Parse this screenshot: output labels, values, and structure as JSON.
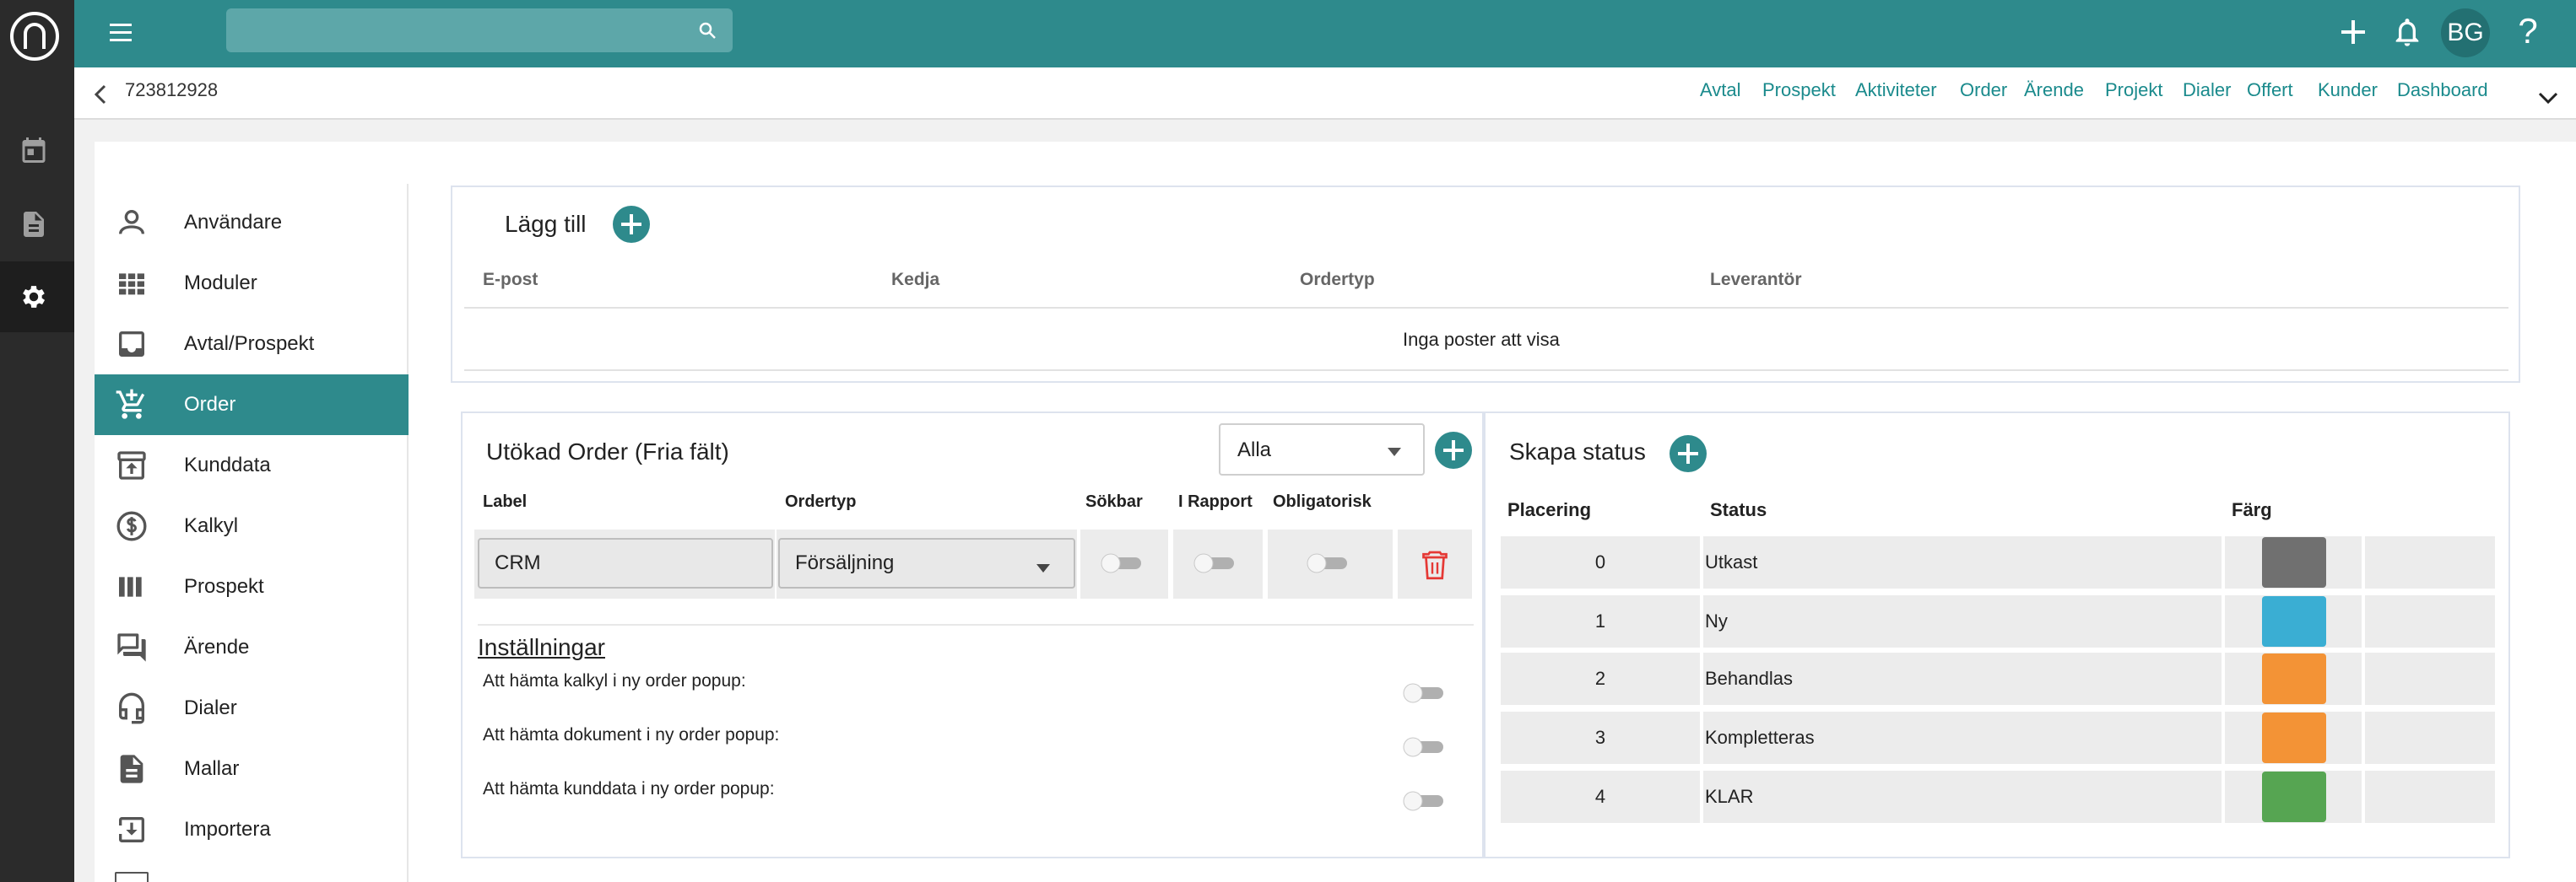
{
  "topbar": {
    "search_placeholder": "",
    "avatar_initials": "BG",
    "help_label": "?"
  },
  "breadcrumb": {
    "record_id": "723812928",
    "links": [
      "Avtal",
      "Prospekt",
      "Aktiviteter",
      "Order",
      "Ärende",
      "Projekt",
      "Dialer",
      "Offert",
      "Kunder",
      "Dashboard"
    ]
  },
  "sidebar": {
    "items": [
      {
        "label": "Användare",
        "icon": "person-icon"
      },
      {
        "label": "Moduler",
        "icon": "grid-icon"
      },
      {
        "label": "Avtal/Prospekt",
        "icon": "inbox-icon"
      },
      {
        "label": "Order",
        "icon": "cart-add-icon",
        "active": true
      },
      {
        "label": "Kunddata",
        "icon": "archive-icon"
      },
      {
        "label": "Kalkyl",
        "icon": "dollar-circle-icon"
      },
      {
        "label": "Prospekt",
        "icon": "columns-icon"
      },
      {
        "label": "Ärende",
        "icon": "forum-icon"
      },
      {
        "label": "Dialer",
        "icon": "headset-icon"
      },
      {
        "label": "Mallar",
        "icon": "document-icon"
      },
      {
        "label": "Importera",
        "icon": "import-icon"
      }
    ]
  },
  "add_panel": {
    "title": "Lägg till",
    "columns": [
      "E-post",
      "Kedja",
      "Ordertyp",
      "Leverantör"
    ],
    "empty_text": "Inga poster att visa"
  },
  "extended_order": {
    "title": "Utökad Order (Fria fält)",
    "filter_value": "Alla",
    "columns": {
      "label": "Label",
      "ordertyp": "Ordertyp",
      "sokbar": "Sökbar",
      "i_rapport": "I Rapport",
      "obligatorisk": "Obligatorisk"
    },
    "row": {
      "label_value": "CRM",
      "ordertyp_value": "Försäljning",
      "sokbar": false,
      "i_rapport": false,
      "obligatorisk": false
    },
    "settings_title": "Inställningar",
    "settings": [
      {
        "label": "Att hämta kalkyl i ny order popup:",
        "enabled": false
      },
      {
        "label": "Att hämta dokument i ny order popup:",
        "enabled": false
      },
      {
        "label": "Att hämta kunddata i ny order popup:",
        "enabled": false
      }
    ]
  },
  "status_panel": {
    "title": "Skapa status",
    "columns": {
      "placering": "Placering",
      "status": "Status",
      "farg": "Färg"
    },
    "rows": [
      {
        "placering": "0",
        "status": "Utkast",
        "color": "#707070"
      },
      {
        "placering": "1",
        "status": "Ny",
        "color": "#3aaed3"
      },
      {
        "placering": "2",
        "status": "Behandlas",
        "color": "#f39336"
      },
      {
        "placering": "3",
        "status": "Kompletteras",
        "color": "#f39336"
      },
      {
        "placering": "4",
        "status": "KLAR",
        "color": "#56a552"
      }
    ]
  },
  "colors": {
    "accent": "#2e8a8c",
    "rail": "#2b2b2b",
    "delete": "#e53935"
  }
}
